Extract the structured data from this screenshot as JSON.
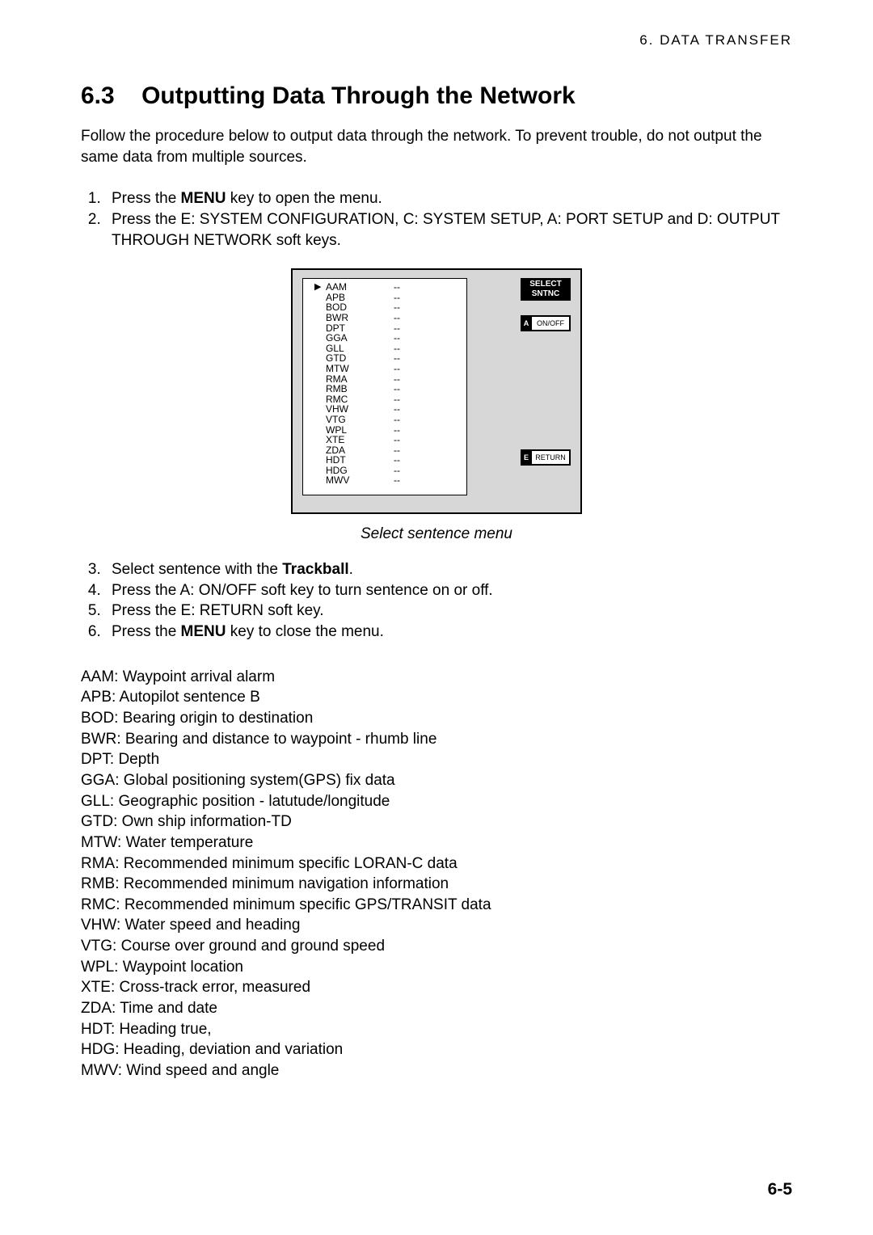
{
  "header": "6.  DATA  TRANSFER",
  "section_number": "6.3",
  "section_title": "Outputting Data Through the Network",
  "intro": "Follow the procedure below to output data through the network. To prevent trouble, do not output the same data from multiple sources.",
  "steps1": [
    {
      "n": "1.",
      "pre": "Press the ",
      "bold": "MENU",
      "post": " key to open the menu."
    },
    {
      "n": "2.",
      "pre": "Press the E: SYSTEM CONFIGURATION, C: SYSTEM SETUP, A: PORT SETUP and D: OUTPUT THROUGH NETWORK soft keys.",
      "bold": "",
      "post": ""
    }
  ],
  "figure": {
    "title_line1": "SELECT",
    "title_line2": "SNTNC",
    "softkey_a_letter": "A",
    "softkey_a_label": "ON/OFF",
    "softkey_e_letter": "E",
    "softkey_e_label": "RETURN",
    "sentences": [
      {
        "code": "AAM",
        "val": "--",
        "selected": true
      },
      {
        "code": "APB",
        "val": "--",
        "selected": false
      },
      {
        "code": "BOD",
        "val": "--",
        "selected": false
      },
      {
        "code": "BWR",
        "val": "--",
        "selected": false
      },
      {
        "code": "DPT",
        "val": "--",
        "selected": false
      },
      {
        "code": "GGA",
        "val": "--",
        "selected": false
      },
      {
        "code": "GLL",
        "val": "--",
        "selected": false
      },
      {
        "code": "GTD",
        "val": "--",
        "selected": false
      },
      {
        "code": "MTW",
        "val": "--",
        "selected": false
      },
      {
        "code": "RMA",
        "val": "--",
        "selected": false
      },
      {
        "code": "RMB",
        "val": "--",
        "selected": false
      },
      {
        "code": "RMC",
        "val": "--",
        "selected": false
      },
      {
        "code": "VHW",
        "val": "--",
        "selected": false
      },
      {
        "code": "VTG",
        "val": "--",
        "selected": false
      },
      {
        "code": "WPL",
        "val": "--",
        "selected": false
      },
      {
        "code": "XTE",
        "val": "--",
        "selected": false
      },
      {
        "code": "ZDA",
        "val": "--",
        "selected": false
      },
      {
        "code": "HDT",
        "val": "--",
        "selected": false
      },
      {
        "code": "HDG",
        "val": "--",
        "selected": false
      },
      {
        "code": "MWV",
        "val": "--",
        "selected": false
      }
    ]
  },
  "caption": "Select sentence menu",
  "steps2": [
    {
      "n": "3.",
      "pre": "Select sentence with the ",
      "bold": "Trackball",
      "post": "."
    },
    {
      "n": "4.",
      "pre": "Press the A: ON/OFF soft key to turn sentence on or off.",
      "bold": "",
      "post": ""
    },
    {
      "n": "5.",
      "pre": "Press the E: RETURN soft key.",
      "bold": "",
      "post": ""
    },
    {
      "n": "6.",
      "pre": "Press the ",
      "bold": "MENU",
      "post": " key to close the menu."
    }
  ],
  "defs": [
    "AAM: Waypoint arrival alarm",
    "APB: Autopilot sentence B",
    "BOD: Bearing origin to destination",
    "BWR: Bearing and distance to waypoint - rhumb line",
    "DPT: Depth",
    "GGA: Global positioning system(GPS) fix data",
    "GLL: Geographic position - latutude/longitude",
    "GTD: Own ship information-TD",
    "MTW: Water temperature",
    "RMA: Recommended minimum specific LORAN-C data",
    "RMB: Recommended minimum navigation information",
    "RMC: Recommended minimum specific GPS/TRANSIT data",
    "VHW: Water speed and heading",
    "VTG: Course over ground and ground speed",
    "WPL: Waypoint location",
    "XTE: Cross-track error, measured",
    "ZDA: Time and date",
    "HDT: Heading true,",
    "HDG: Heading, deviation and variation",
    "MWV: Wind speed and angle"
  ],
  "page_num": "6-5"
}
